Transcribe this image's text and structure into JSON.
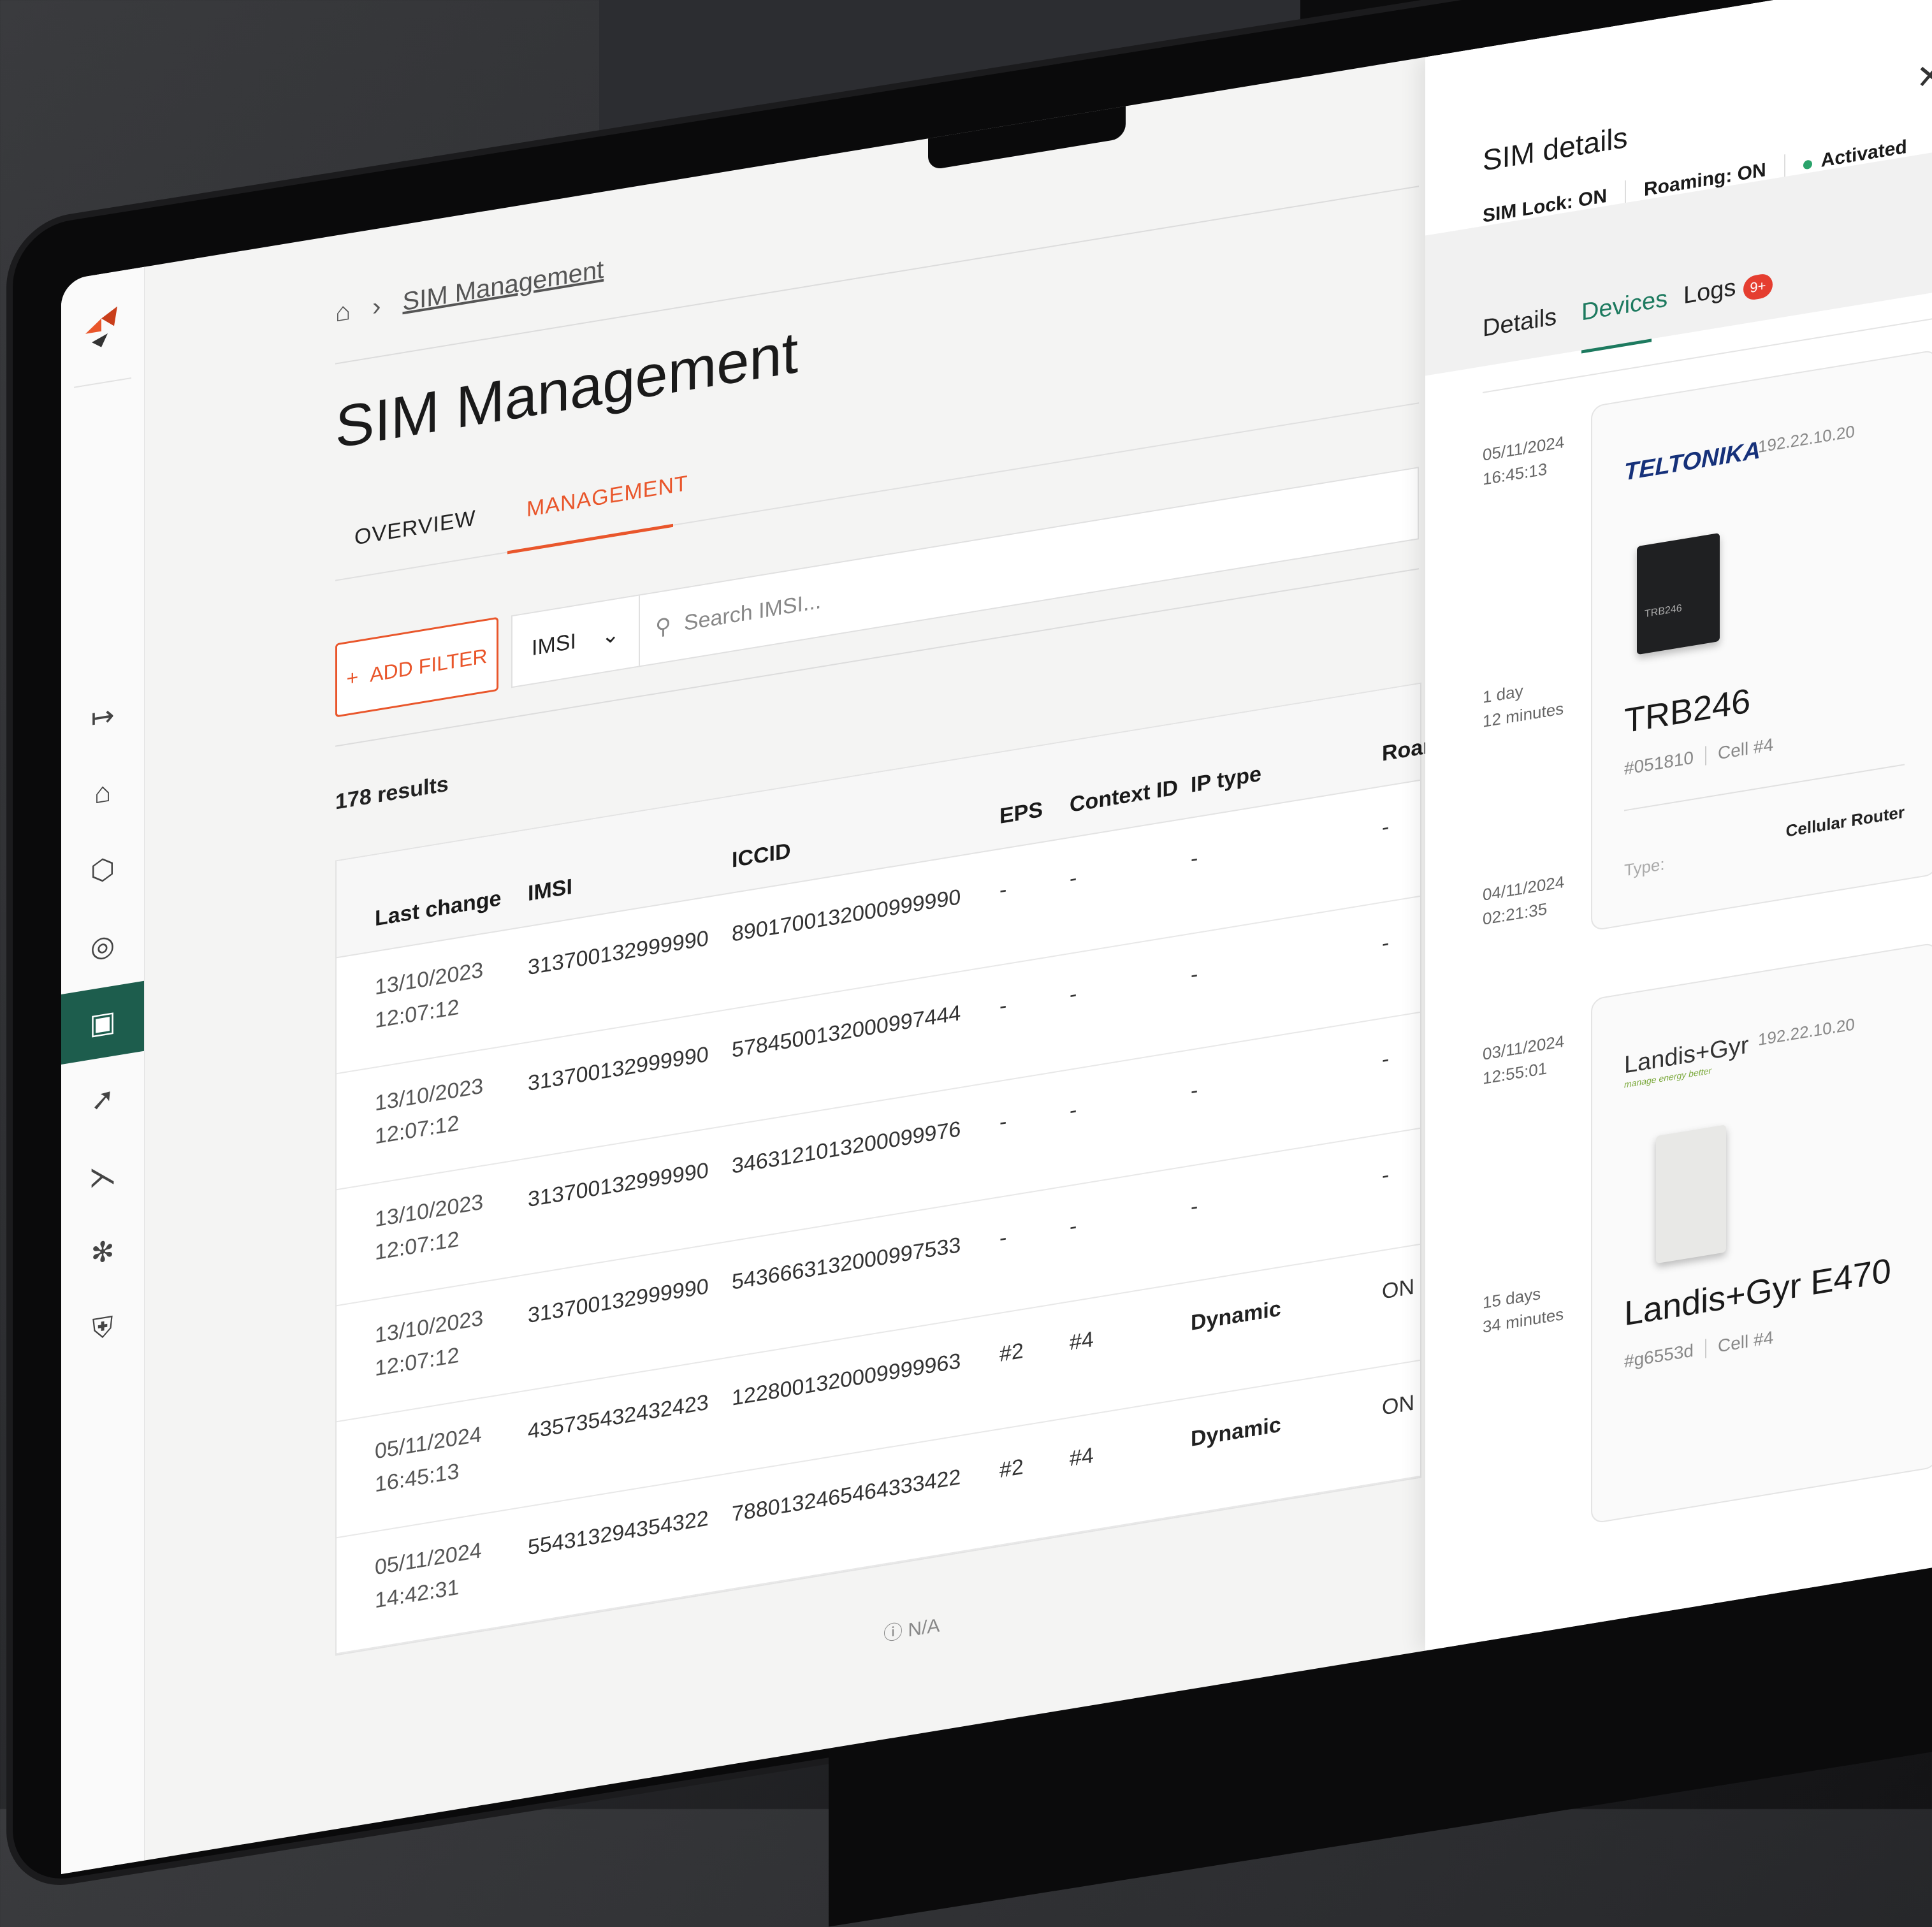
{
  "breadcrumb": {
    "current": "SIM Management"
  },
  "page": {
    "title": "SIM Management"
  },
  "tabs": {
    "overview": "OVERVIEW",
    "management": "MANAGEMENT"
  },
  "toolbar": {
    "add_filter": "ADD FILTER",
    "search_field": "IMSI",
    "search_placeholder": "Search IMSI..."
  },
  "results": {
    "count_label": "178 results"
  },
  "table": {
    "headers": {
      "last_change": "Last change",
      "imsi": "IMSI",
      "iccid": "ICCID",
      "eps": "EPS",
      "context_id": "Context ID",
      "ip_type": "IP type",
      "roaming": "Roar"
    },
    "rows": [
      {
        "date": "13/10/2023",
        "time": "12:07:12",
        "imsi": "313700132999990",
        "iccid": "8901700132000999990",
        "eps": "-",
        "context_id": "-",
        "ip_type": "-",
        "roaming": "-"
      },
      {
        "date": "13/10/2023",
        "time": "12:07:12",
        "imsi": "313700132999990",
        "iccid": "5784500132000997444",
        "eps": "-",
        "context_id": "-",
        "ip_type": "-",
        "roaming": "-"
      },
      {
        "date": "13/10/2023",
        "time": "12:07:12",
        "imsi": "313700132999990",
        "iccid": "3463121013200099976",
        "eps": "-",
        "context_id": "-",
        "ip_type": "-",
        "roaming": "-"
      },
      {
        "date": "13/10/2023",
        "time": "12:07:12",
        "imsi": "313700132999990",
        "iccid": "5436663132000997533",
        "eps": "-",
        "context_id": "-",
        "ip_type": "-",
        "roaming": "-"
      },
      {
        "date": "05/11/2024",
        "time": "16:45:13",
        "imsi": "435735432432423",
        "iccid": "1228001320009999963",
        "eps": "#2",
        "context_id": "#4",
        "ip_type": "Dynamic",
        "roaming": "ON"
      },
      {
        "date": "05/11/2024",
        "time": "14:42:31",
        "imsi": "554313294354322",
        "iccid": "7880132465464333422",
        "eps": "#2",
        "context_id": "#4",
        "ip_type": "Dynamic",
        "roaming": "ON"
      }
    ],
    "na_label": "N/A"
  },
  "panel": {
    "title": "SIM details",
    "sim_lock": "SIM Lock: ON",
    "roaming": "Roaming: ON",
    "status": "Activated",
    "status_color": "#2aa36b",
    "tabs": {
      "details": "Details",
      "devices": "Devices",
      "logs": "Logs",
      "logs_badge": "9+"
    },
    "timeline": [
      {
        "date": "05/11/2024",
        "time": "16:45:13"
      },
      {
        "line1": "1 day",
        "line2": "12 minutes"
      },
      {
        "date": "04/11/2024",
        "time": "02:21:35"
      },
      {
        "date": "03/11/2024",
        "time": "12:55:01"
      },
      {
        "line1": "15 days",
        "line2": "34 minutes"
      }
    ],
    "devices": [
      {
        "brand": "TELTONIKA",
        "ip": "192.22.10.20",
        "name": "TRB246",
        "id": "#051810",
        "cell": "Cell #4",
        "type_label": "Type:",
        "type_value": "Cellular Router",
        "image_label": "TRB246"
      },
      {
        "brand": "Landis+Gyr",
        "tagline": "manage energy better",
        "ip": "192.22.10.20",
        "name": "Landis+Gyr E470",
        "id": "#g6553d",
        "cell": "Cell #4"
      }
    ]
  },
  "colors": {
    "accent": "#e9562b",
    "sidebar_active": "#1d5d4d",
    "tab_active_panel": "#1d7a5f",
    "badge": "#e53e30"
  }
}
